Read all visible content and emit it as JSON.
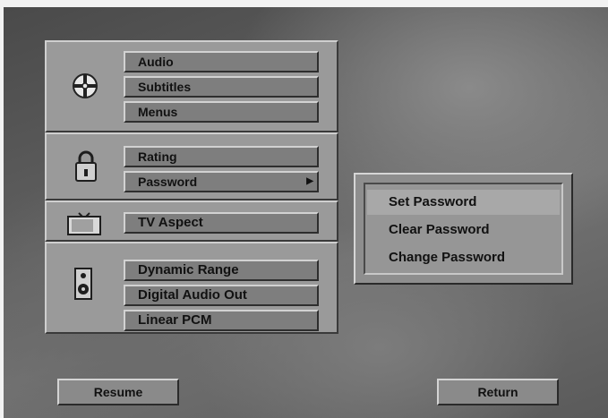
{
  "menu": {
    "disc_group": {
      "icon": "disc-icon",
      "items": [
        "Audio",
        "Subtitles",
        "Menus"
      ]
    },
    "lock_group": {
      "icon": "lock-icon",
      "items": [
        "Rating",
        "Password"
      ]
    },
    "tv_group": {
      "icon": "tv-icon",
      "items": [
        "TV Aspect"
      ]
    },
    "speaker_group": {
      "icon": "speaker-icon",
      "items": [
        "Dynamic Range",
        "Digital Audio Out",
        "Linear PCM"
      ]
    }
  },
  "submenu": {
    "items": [
      "Set Password",
      "Clear Password",
      "Change Password"
    ],
    "selected": "Set Password"
  },
  "bottom": {
    "resume": "Resume",
    "return": "Return"
  },
  "colors": {
    "panel": "#9a9a9a",
    "button": "#7e7e7e",
    "highlight": "#a8a8a8"
  }
}
